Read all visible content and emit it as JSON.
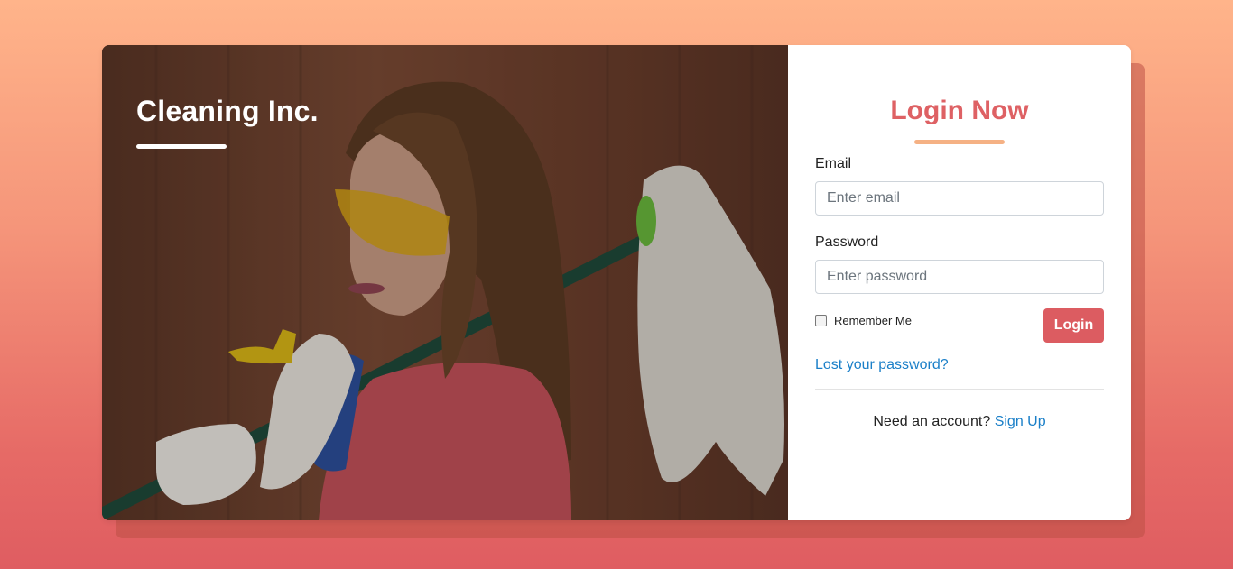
{
  "brand": {
    "name": "Cleaning Inc."
  },
  "hero": {
    "image_subject": "woman holding mop and spray bottle"
  },
  "login": {
    "title": "Login Now",
    "email_label": "Email",
    "email_placeholder": "Enter email",
    "email_value": "",
    "password_label": "Password",
    "password_placeholder": "Enter password",
    "password_value": "",
    "remember_label": "Remember Me",
    "remember_checked": false,
    "submit_label": "Login",
    "lost_password_link": "Lost your password?",
    "signup_prompt": "Need an account?",
    "signup_link": "Sign Up"
  },
  "colors": {
    "accent": "#dc5c61",
    "underline": "#f5b184",
    "link": "#1a7fc8",
    "background_top": "#ffb48a",
    "background_bottom": "#df5d61"
  }
}
